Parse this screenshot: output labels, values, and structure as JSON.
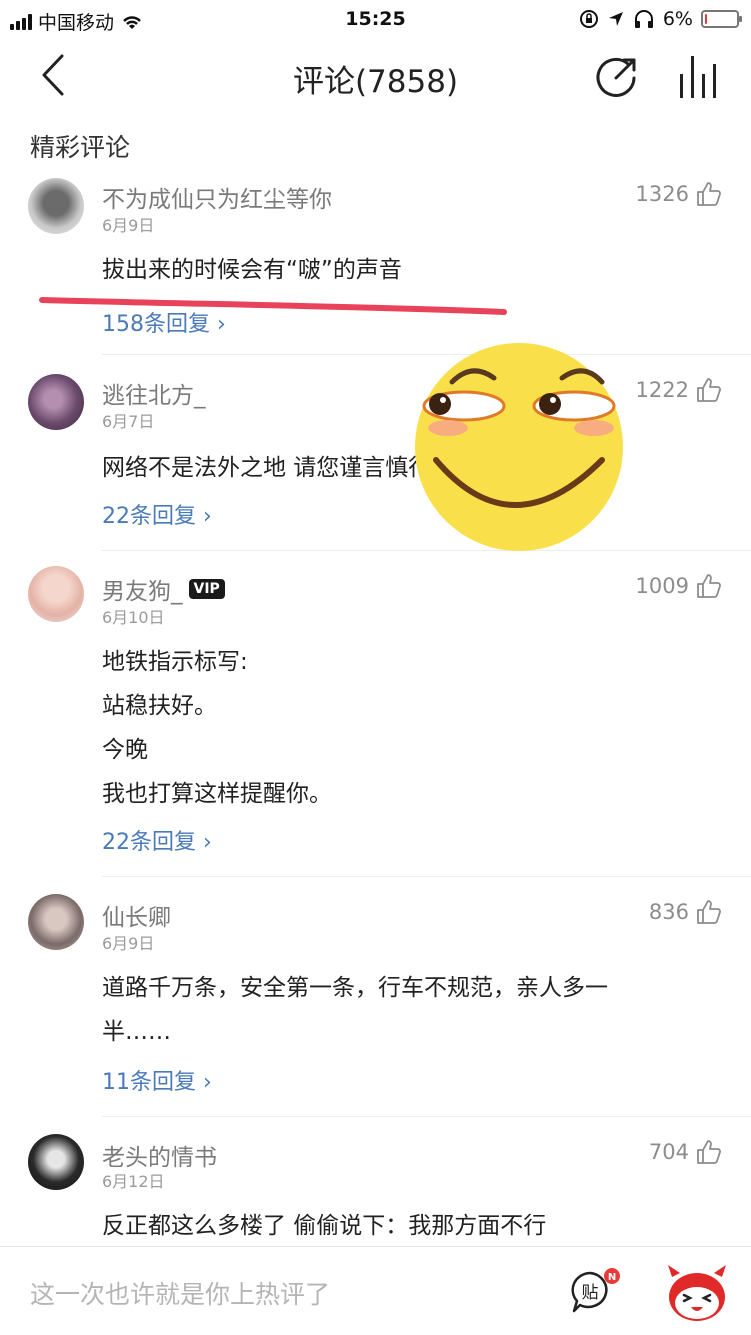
{
  "status_bar": {
    "carrier": "中国移动",
    "time": "15:25",
    "battery": "6%",
    "battery_level": 0.06
  },
  "nav": {
    "title": "评论(7858)"
  },
  "section_title": "精彩评论",
  "comments": [
    {
      "user": "不为成仙只为红尘等你",
      "date": "6月9日",
      "likes": "1326",
      "lines": [
        "拔出来的时候会有“啵”的声音"
      ],
      "replies": "158条回复"
    },
    {
      "user": "逃往北方_",
      "date": "6月7日",
      "likes": "1222",
      "lines": [
        "网络不是法外之地 请您谨言慎行"
      ],
      "replies": "22条回复"
    },
    {
      "user": "男友狗_",
      "badge": "VIP",
      "date": "6月10日",
      "likes": "1009",
      "lines": [
        "地铁指示标写:",
        "站稳扶好。",
        "今晚",
        "我也打算这样提醒你。"
      ],
      "replies": "22条回复"
    },
    {
      "user": "仙长卿",
      "date": "6月9日",
      "likes": "836",
      "lines": [
        "道路千万条，安全第一条，行车不规范，亲人多一",
        "半……"
      ],
      "replies": "11条回复"
    },
    {
      "user": "老头的情书",
      "date": "6月12日",
      "likes": "704",
      "lines": [
        "反正都这么多楼了 偷偷说下：我那方面不行"
      ]
    }
  ],
  "bottom_bar": {
    "placeholder": "这一次也许就是你上热评了",
    "tie_label": "贴",
    "tie_badge": "N"
  }
}
